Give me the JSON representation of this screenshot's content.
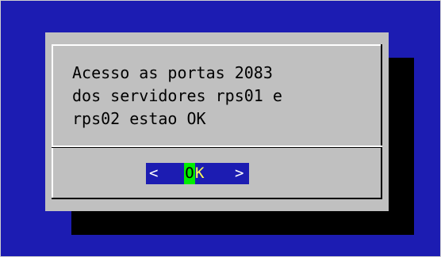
{
  "colors": {
    "screen_background": "#1c1cb2",
    "dialog_background": "#c0c0c0",
    "shadow": "#000000",
    "button_background": "#1c1cb2",
    "button_hotkey": "#00ee00",
    "button_text": "#ffff55"
  },
  "dialog": {
    "message_lines": [
      "Acesso as portas 2083",
      "dos servidores rps01 e",
      "rps02 estao OK"
    ],
    "ok_button": {
      "left_bracket": "<",
      "hotkey": "O",
      "label_rest": "K",
      "right_bracket": ">"
    }
  }
}
